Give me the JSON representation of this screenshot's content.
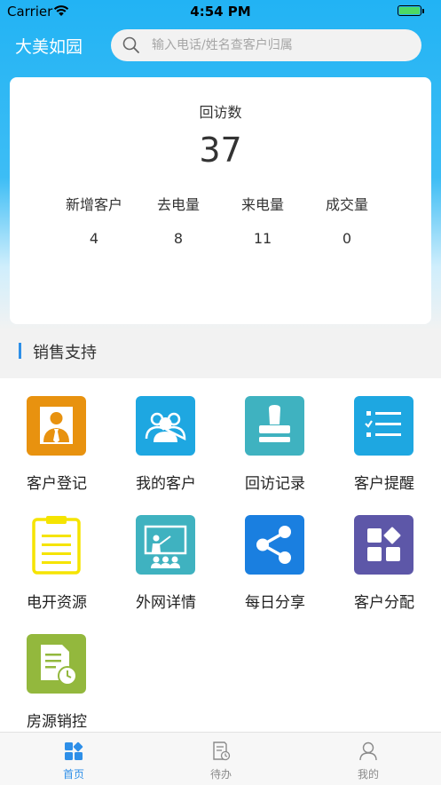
{
  "status_bar": {
    "carrier": "Carrier",
    "time": "4:54 PM"
  },
  "header": {
    "brand": "大美如园",
    "search_placeholder": "输入电话/姓名查客户归属"
  },
  "stats": {
    "title": "回访数",
    "total": "37",
    "items": [
      {
        "label": "新增客户",
        "value": "4"
      },
      {
        "label": "去电量",
        "value": "8"
      },
      {
        "label": "来电量",
        "value": "11"
      },
      {
        "label": "成交量",
        "value": "0"
      }
    ]
  },
  "section": {
    "title": "销售支持"
  },
  "menu": [
    {
      "label": "客户登记",
      "icon": "person-tie-icon",
      "color": "#e8920f"
    },
    {
      "label": "我的客户",
      "icon": "users-icon",
      "color": "#1ea7e1"
    },
    {
      "label": "回访记录",
      "icon": "stamp-icon",
      "color": "#3fb2c0"
    },
    {
      "label": "客户提醒",
      "icon": "checklist-icon",
      "color": "#1ea7e1"
    },
    {
      "label": "电开资源",
      "icon": "clipboard-icon",
      "color": "#ffffff"
    },
    {
      "label": "外网详情",
      "icon": "presentation-icon",
      "color": "#3fb2c0"
    },
    {
      "label": "每日分享",
      "icon": "share-icon",
      "color": "#1a7fe0"
    },
    {
      "label": "客户分配",
      "icon": "apps-icon",
      "color": "#5d57a8"
    },
    {
      "label": "房源销控",
      "icon": "document-clock-icon",
      "color": "#93b83d"
    }
  ],
  "tabs": [
    {
      "label": "首页",
      "icon": "home-grid-icon",
      "active": true
    },
    {
      "label": "待办",
      "icon": "todo-icon",
      "active": false
    },
    {
      "label": "我的",
      "icon": "profile-icon",
      "active": false
    }
  ],
  "colors": {
    "accent": "#2e8fe8",
    "header_blue": "#22b3f4",
    "tab_active": "#2e8fe8",
    "tab_inactive": "#8a8a8a"
  }
}
